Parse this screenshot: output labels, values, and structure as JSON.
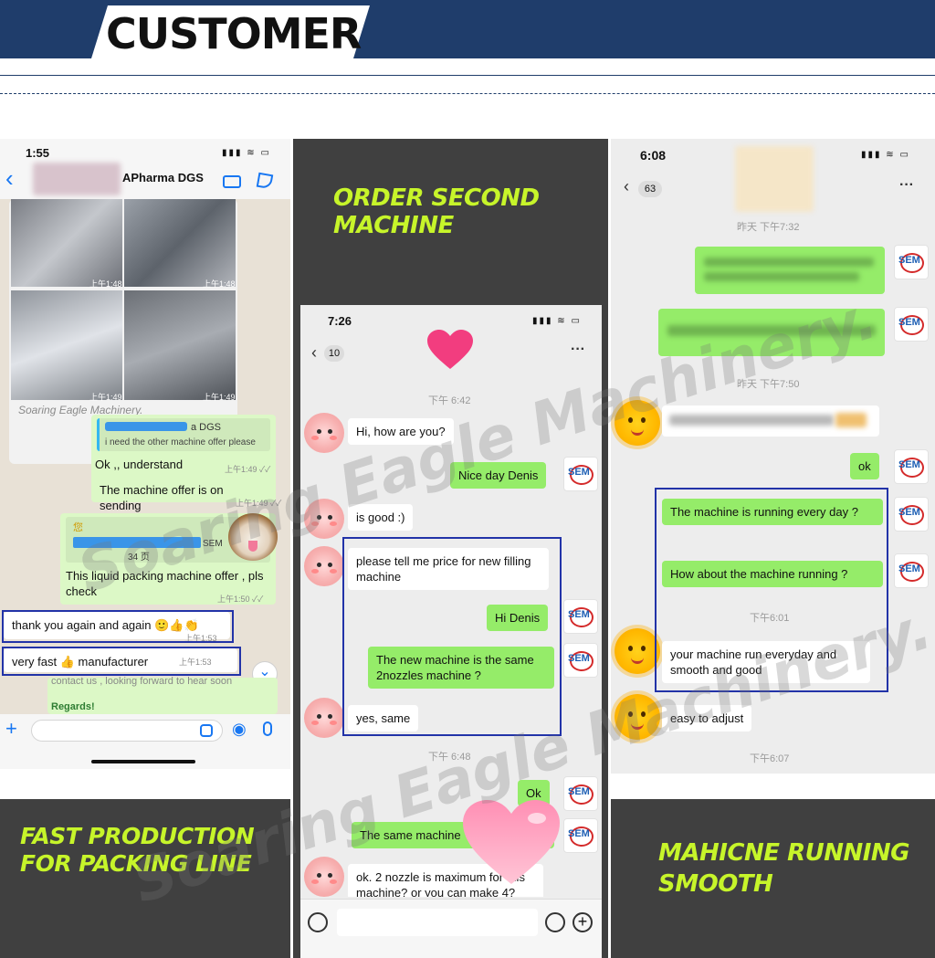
{
  "header": {
    "title": "CUSTOMER"
  },
  "panel1": {
    "status_time": "1:55",
    "status_icons": "▮▮▮ ≋ ▭",
    "back_glyph": "‹",
    "chat_name": "APharma DGS",
    "photo_times": [
      "上午1:48",
      "上午1:48",
      "上午1:49",
      "上午1:49"
    ],
    "watermark_small": "Soaring Eagle Machinery.",
    "quote_name": "a DGS",
    "quote_text": "i need the other machine offer please",
    "msg1": "Ok ,, understand",
    "msg1_time": "上午1:49 ✓✓",
    "msg2": "The machine offer is on sending",
    "msg2_time": "上午1:49 ✓✓",
    "file_label_1": "您",
    "file_label_2": "SEM",
    "file_pages": "34 页",
    "msg3": "This liquid packing machine offer , pls check",
    "msg3_time": "上午1:50 ✓✓",
    "msg4": "thank you again and again  🙂👍👏",
    "msg4_time": "上午1:53",
    "msg5": "very fast 👍 manufacturer",
    "msg5_time": "上午1:53",
    "msg6_partial": "contact us , looking forward to hear soon",
    "msg7": "Regards!",
    "scroll_down_icon": "⌄",
    "input_plus": "+",
    "input_camera": "◉",
    "input_mic": "🎙"
  },
  "promo_top": {
    "text": "ORDER SECOND\nMACHINE"
  },
  "panel2": {
    "status_time": "7:26",
    "status_icons": "▮▮▮ ≋ ▭",
    "back_count": "10",
    "more_icon": "···",
    "time1": "下午 6:42",
    "msg_hi": "Hi, how are you?",
    "msg_nice": "Nice day Denis",
    "msg_good": "is good :)",
    "msg_price": "please tell me price for new filling machine",
    "msg_hi_denis": "Hi Denis",
    "msg_same": "The new machine is the same 2nozzles machine ?",
    "msg_yes": "yes, same",
    "time2": "下午 6:48",
    "msg_ok": "Ok",
    "msg_same_machine": "The same machine",
    "msg_nozzle": "ok. 2 nozzle is maximum for this machine? or you can make 4?",
    "avatar_label": "SEM"
  },
  "panel3": {
    "status_time": "6:08",
    "status_icons": "▮▮▮ ≋ ▭",
    "back_count": "63",
    "more_icon": "···",
    "time1": "昨天 下午7:32",
    "time2": "昨天 下午7:50",
    "msg_ok": "ok",
    "msg_running": "The machine is running every day ?",
    "msg_how": "How about the machine running ?",
    "time3": "下午6:01",
    "msg_reply": "your machine run everyday and smooth and good",
    "msg_easy": "easy to adjust",
    "time4": "下午6:07",
    "avatar_label": "SEM"
  },
  "promo_left": {
    "text": "FAST PRODUCTION\nFOR PACKING LINE"
  },
  "promo_right": {
    "text": "MAHICNE RUNNING\nSMOOTH"
  },
  "watermark": {
    "text": "Soaring Eagle Machinery."
  },
  "colors": {
    "navy": "#1f3d6b",
    "lime": "#c7f52a",
    "wechat_green": "#95ec69",
    "highlight": "#2233a8"
  }
}
